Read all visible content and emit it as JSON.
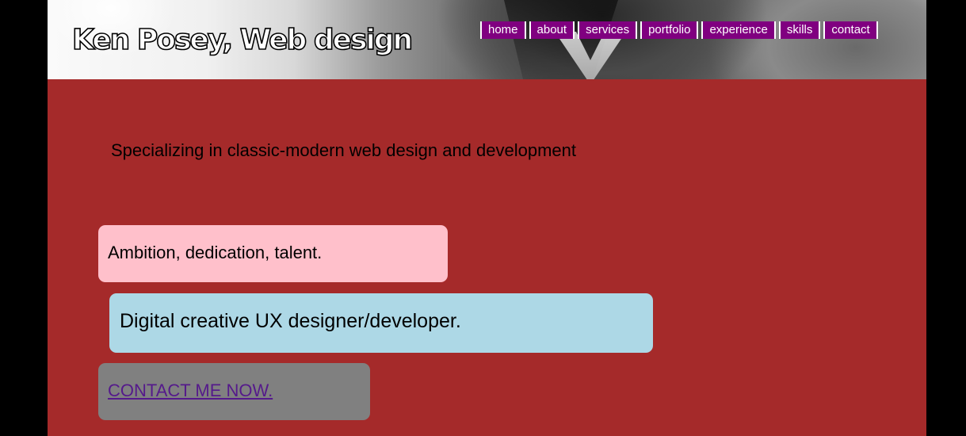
{
  "header": {
    "site_title": "Ken Posey, Web design"
  },
  "nav": {
    "items": [
      {
        "label": "home"
      },
      {
        "label": "about"
      },
      {
        "label": "services"
      },
      {
        "label": "portfolio"
      },
      {
        "label": "experience"
      },
      {
        "label": "skills"
      },
      {
        "label": "contact"
      }
    ]
  },
  "main": {
    "tagline": "Specializing in classic-modern web design and development",
    "box_1": "Ambition, dedication, talent.",
    "box_2": "Digital creative UX designer/developer.",
    "contact_link": "CONTACT ME NOW."
  },
  "colors": {
    "page_background": "#a52a2a",
    "outer_background": "#000000",
    "nav_background": "#800080",
    "box_pink": "#ffc0cb",
    "box_blue": "#add8e6",
    "box_gray": "#808080",
    "link_color": "#551a8b"
  }
}
